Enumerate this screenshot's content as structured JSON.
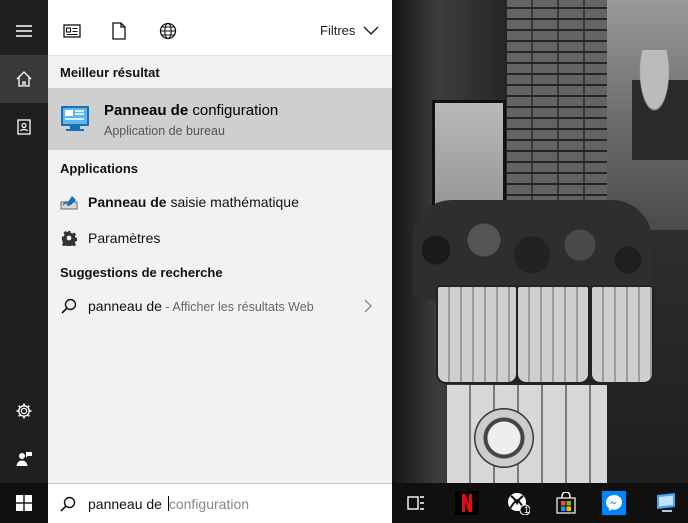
{
  "toolbar": {
    "filters_label": "Filtres"
  },
  "results": {
    "best_heading": "Meilleur résultat",
    "best": {
      "title_bold": "Panneau de",
      "title_rest": " configuration",
      "subtitle": "Application de bureau"
    },
    "apps_heading": "Applications",
    "apps": [
      {
        "bold": "Panneau de",
        "rest": " saisie mathématique",
        "icon": "math-input-icon"
      },
      {
        "bold": "",
        "rest": "Paramètres",
        "icon": "gear-icon"
      }
    ],
    "suggest_heading": "Suggestions de recherche",
    "suggestion": {
      "query": "panneau de",
      "hint": " - Afficher les résultats Web"
    }
  },
  "search": {
    "typed": "panneau de ",
    "autocomplete": "configuration"
  },
  "taskbar": {
    "xbox_badge": "1"
  },
  "colors": {
    "panel_bg": "#f2f2f2",
    "selected_bg": "#cfcfcf",
    "rail_bg": "#1f1f1f",
    "taskbar_bg": "#101010",
    "netflix_red": "#e50914",
    "messenger_blue": "#0084ff"
  }
}
